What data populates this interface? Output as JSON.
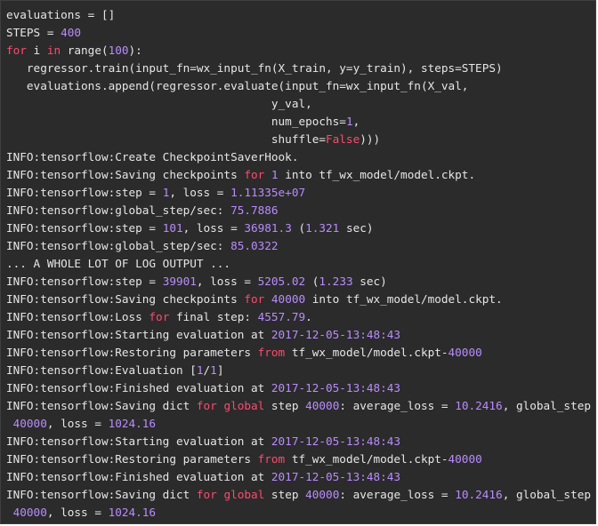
{
  "code": {
    "lines": [
      [
        {
          "t": "evaluations = []",
          "k": "plain"
        }
      ],
      [
        {
          "t": "STEPS = ",
          "k": "plain"
        },
        {
          "t": "400",
          "k": "num"
        }
      ],
      [
        {
          "t": "for",
          "k": "kw"
        },
        {
          "t": " i ",
          "k": "plain"
        },
        {
          "t": "in",
          "k": "kw"
        },
        {
          "t": " range(",
          "k": "plain"
        },
        {
          "t": "100",
          "k": "num"
        },
        {
          "t": "):",
          "k": "plain"
        }
      ],
      [
        {
          "t": "   regressor.train(input_fn=wx_input_fn(X_train, y=y_train), steps=STEPS)",
          "k": "plain"
        }
      ],
      [
        {
          "t": "   evaluations.append(regressor.evaluate(input_fn=wx_input_fn(X_val,",
          "k": "plain"
        }
      ],
      [
        {
          "t": "                                       y_val,",
          "k": "plain"
        }
      ],
      [
        {
          "t": "                                       num_epochs=",
          "k": "plain"
        },
        {
          "t": "1",
          "k": "num"
        },
        {
          "t": ",",
          "k": "plain"
        }
      ],
      [
        {
          "t": "                                       shuffle=",
          "k": "plain"
        },
        {
          "t": "False",
          "k": "const"
        },
        {
          "t": ")))",
          "k": "plain"
        }
      ],
      [
        {
          "t": "INFO:tensorflow:Create CheckpointSaverHook.",
          "k": "plain"
        }
      ],
      [
        {
          "t": "INFO:tensorflow:Saving checkpoints ",
          "k": "plain"
        },
        {
          "t": "for",
          "k": "kw"
        },
        {
          "t": " ",
          "k": "plain"
        },
        {
          "t": "1",
          "k": "num"
        },
        {
          "t": " into tf_wx_model/model.ckpt.",
          "k": "plain"
        }
      ],
      [
        {
          "t": "INFO:tensorflow:step = ",
          "k": "plain"
        },
        {
          "t": "1",
          "k": "num"
        },
        {
          "t": ", loss = ",
          "k": "plain"
        },
        {
          "t": "1.11335e+07",
          "k": "num"
        }
      ],
      [
        {
          "t": "INFO:tensorflow:global_step/sec: ",
          "k": "plain"
        },
        {
          "t": "75.7886",
          "k": "num"
        }
      ],
      [
        {
          "t": "INFO:tensorflow:step = ",
          "k": "plain"
        },
        {
          "t": "101",
          "k": "num"
        },
        {
          "t": ", loss = ",
          "k": "plain"
        },
        {
          "t": "36981.3",
          "k": "num"
        },
        {
          "t": " (",
          "k": "plain"
        },
        {
          "t": "1.321",
          "k": "num"
        },
        {
          "t": " sec)",
          "k": "plain"
        }
      ],
      [
        {
          "t": "INFO:tensorflow:global_step/sec: ",
          "k": "plain"
        },
        {
          "t": "85.0322",
          "k": "num"
        }
      ],
      [
        {
          "t": "... A WHOLE LOT OF LOG OUTPUT ...",
          "k": "plain"
        }
      ],
      [
        {
          "t": "INFO:tensorflow:step = ",
          "k": "plain"
        },
        {
          "t": "39901",
          "k": "num"
        },
        {
          "t": ", loss = ",
          "k": "plain"
        },
        {
          "t": "5205.02",
          "k": "num"
        },
        {
          "t": " (",
          "k": "plain"
        },
        {
          "t": "1.233",
          "k": "num"
        },
        {
          "t": " sec)",
          "k": "plain"
        }
      ],
      [
        {
          "t": "INFO:tensorflow:Saving checkpoints ",
          "k": "plain"
        },
        {
          "t": "for",
          "k": "kw"
        },
        {
          "t": " ",
          "k": "plain"
        },
        {
          "t": "40000",
          "k": "num"
        },
        {
          "t": " into tf_wx_model/model.ckpt.",
          "k": "plain"
        }
      ],
      [
        {
          "t": "INFO:tensorflow:Loss ",
          "k": "plain"
        },
        {
          "t": "for",
          "k": "kw"
        },
        {
          "t": " final step: ",
          "k": "plain"
        },
        {
          "t": "4557.79",
          "k": "num"
        },
        {
          "t": ".",
          "k": "plain"
        }
      ],
      [
        {
          "t": "INFO:tensorflow:Starting evaluation at ",
          "k": "plain"
        },
        {
          "t": "2017-12-05-13:48:43",
          "k": "num"
        }
      ],
      [
        {
          "t": "INFO:tensorflow:Restoring parameters ",
          "k": "plain"
        },
        {
          "t": "from",
          "k": "kw"
        },
        {
          "t": " tf_wx_model/model.ckpt-",
          "k": "plain"
        },
        {
          "t": "40000",
          "k": "num"
        }
      ],
      [
        {
          "t": "INFO:tensorflow:Evaluation [",
          "k": "plain"
        },
        {
          "t": "1",
          "k": "num"
        },
        {
          "t": "/",
          "k": "plain"
        },
        {
          "t": "1",
          "k": "num"
        },
        {
          "t": "]",
          "k": "plain"
        }
      ],
      [
        {
          "t": "INFO:tensorflow:Finished evaluation at ",
          "k": "plain"
        },
        {
          "t": "2017-12-05-13:48:43",
          "k": "num"
        }
      ],
      [
        {
          "t": "INFO:tensorflow:Saving dict ",
          "k": "plain"
        },
        {
          "t": "for",
          "k": "kw"
        },
        {
          "t": " ",
          "k": "plain"
        },
        {
          "t": "global",
          "k": "kw"
        },
        {
          "t": " step ",
          "k": "plain"
        },
        {
          "t": "40000",
          "k": "num"
        },
        {
          "t": ": average_loss = ",
          "k": "plain"
        },
        {
          "t": "10.2416",
          "k": "num"
        },
        {
          "t": ", global_step =",
          "k": "plain"
        }
      ],
      [
        {
          "t": " ",
          "k": "plain"
        },
        {
          "t": "40000",
          "k": "num"
        },
        {
          "t": ", loss = ",
          "k": "plain"
        },
        {
          "t": "1024.16",
          "k": "num"
        }
      ],
      [
        {
          "t": "INFO:tensorflow:Starting evaluation at ",
          "k": "plain"
        },
        {
          "t": "2017-12-05-13:48:43",
          "k": "num"
        }
      ],
      [
        {
          "t": "INFO:tensorflow:Restoring parameters ",
          "k": "plain"
        },
        {
          "t": "from",
          "k": "kw"
        },
        {
          "t": " tf_wx_model/model.ckpt-",
          "k": "plain"
        },
        {
          "t": "40000",
          "k": "num"
        }
      ],
      [
        {
          "t": "INFO:tensorflow:Finished evaluation at ",
          "k": "plain"
        },
        {
          "t": "2017-12-05-13:48:43",
          "k": "num"
        }
      ],
      [
        {
          "t": "INFO:tensorflow:Saving dict ",
          "k": "plain"
        },
        {
          "t": "for",
          "k": "kw"
        },
        {
          "t": " ",
          "k": "plain"
        },
        {
          "t": "global",
          "k": "kw"
        },
        {
          "t": " step ",
          "k": "plain"
        },
        {
          "t": "40000",
          "k": "num"
        },
        {
          "t": ": average_loss = ",
          "k": "plain"
        },
        {
          "t": "10.2416",
          "k": "num"
        },
        {
          "t": ", global_step =",
          "k": "plain"
        }
      ],
      [
        {
          "t": " ",
          "k": "plain"
        },
        {
          "t": "40000",
          "k": "num"
        },
        {
          "t": ", loss = ",
          "k": "plain"
        },
        {
          "t": "1024.16",
          "k": "num"
        }
      ]
    ]
  },
  "colors": {
    "background": "#2b2b2b",
    "text": "#e6e6e6",
    "keyword": "#ff4a6e",
    "number": "#b98cff"
  }
}
